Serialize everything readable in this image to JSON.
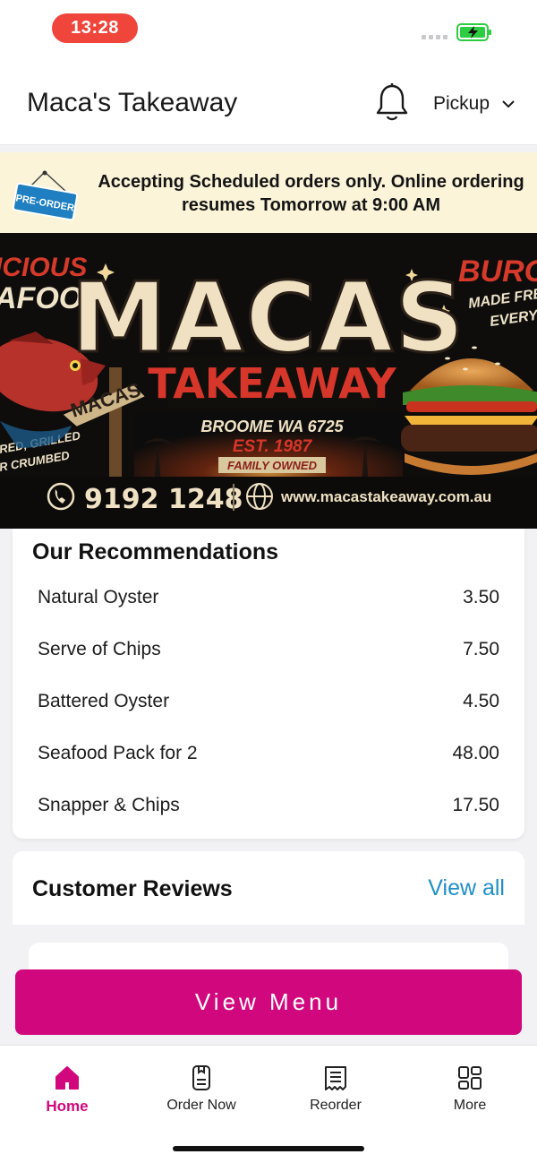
{
  "status_bar": {
    "time": "13:28",
    "battery_color": "#2ecc40"
  },
  "header": {
    "title": "Maca's Takeaway",
    "order_mode": "Pickup"
  },
  "notice": {
    "badge": "PRE-ORDER",
    "text": "Accepting Scheduled orders only. Online ordering resumes Tomorrow at 9:00 AM"
  },
  "banner": {
    "left_tag_1": "ICIOUS",
    "left_tag_2": "AFOOD",
    "left_tag_3": "RED, GRILLED",
    "left_tag_4": "R CRUMBED",
    "sign": "MACAS",
    "brand": "MACAS",
    "brand_sub": "TAKEAWAY",
    "location": "BROOME WA 6725",
    "established": "EST. 1987",
    "family": "FAMILY OWNED",
    "right_tag_1": "BURGE",
    "right_tag_2": "MADE FRES",
    "right_tag_3": "EVERYD",
    "phone": "9192 1248",
    "website": "www.macastakeaway.com.au"
  },
  "recommendations": {
    "title": "Our Recommendations",
    "items": [
      {
        "name": "Natural Oyster",
        "price": "3.50"
      },
      {
        "name": "Serve of Chips",
        "price": "7.50"
      },
      {
        "name": "Battered Oyster",
        "price": "4.50"
      },
      {
        "name": "Seafood Pack for 2",
        "price": "48.00"
      },
      {
        "name": "Snapper & Chips",
        "price": "17.50"
      }
    ]
  },
  "reviews": {
    "title": "Customer Reviews",
    "view_all": "View all"
  },
  "cta": {
    "view_menu": "View Menu",
    "color": "#d1087d"
  },
  "tabs": [
    {
      "label": "Home",
      "icon": "home-icon",
      "active": true
    },
    {
      "label": "Order Now",
      "icon": "order-icon",
      "active": false
    },
    {
      "label": "Reorder",
      "icon": "receipt-icon",
      "active": false
    },
    {
      "label": "More",
      "icon": "grid-icon",
      "active": false
    }
  ]
}
